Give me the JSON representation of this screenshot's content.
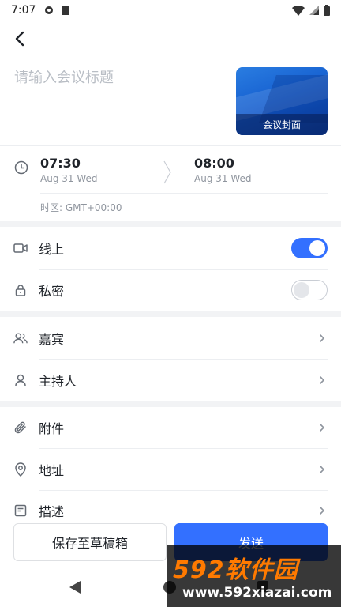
{
  "status_bar": {
    "time": "7:07",
    "icons_left": [
      "gear-icon",
      "sim-card-icon"
    ],
    "icons_right": [
      "wifi-icon",
      "signal-icon",
      "battery-icon"
    ]
  },
  "nav": {
    "back_icon": "chevron-left-icon"
  },
  "title": {
    "placeholder": "请输入会议标题",
    "value": ""
  },
  "cover": {
    "label": "会议封面"
  },
  "time": {
    "start_time": "07:30",
    "start_date": "Aug 31 Wed",
    "end_time": "08:00",
    "end_date": "Aug 31 Wed",
    "timezone": "时区: GMT+00:00"
  },
  "settings": {
    "online": {
      "label": "线上",
      "enabled": true,
      "icon": "video-camera-icon"
    },
    "private": {
      "label": "私密",
      "enabled": false,
      "icon": "lock-icon"
    }
  },
  "people": [
    {
      "label": "嘉宾",
      "icon": "users-icon"
    },
    {
      "label": "主持人",
      "icon": "user-icon"
    }
  ],
  "details": [
    {
      "label": "附件",
      "icon": "paperclip-icon"
    },
    {
      "label": "地址",
      "icon": "location-pin-icon"
    },
    {
      "label": "描述",
      "icon": "document-icon"
    }
  ],
  "actions": {
    "draft_label": "保存至草稿箱",
    "send_label": "发送"
  },
  "colors": {
    "accent": "#3370ff",
    "text": "#1f2329",
    "muted": "#8f959e",
    "placeholder": "#b9bec5"
  },
  "watermark": {
    "line1": "592软件园",
    "line2": "www.592xiazai.com"
  }
}
